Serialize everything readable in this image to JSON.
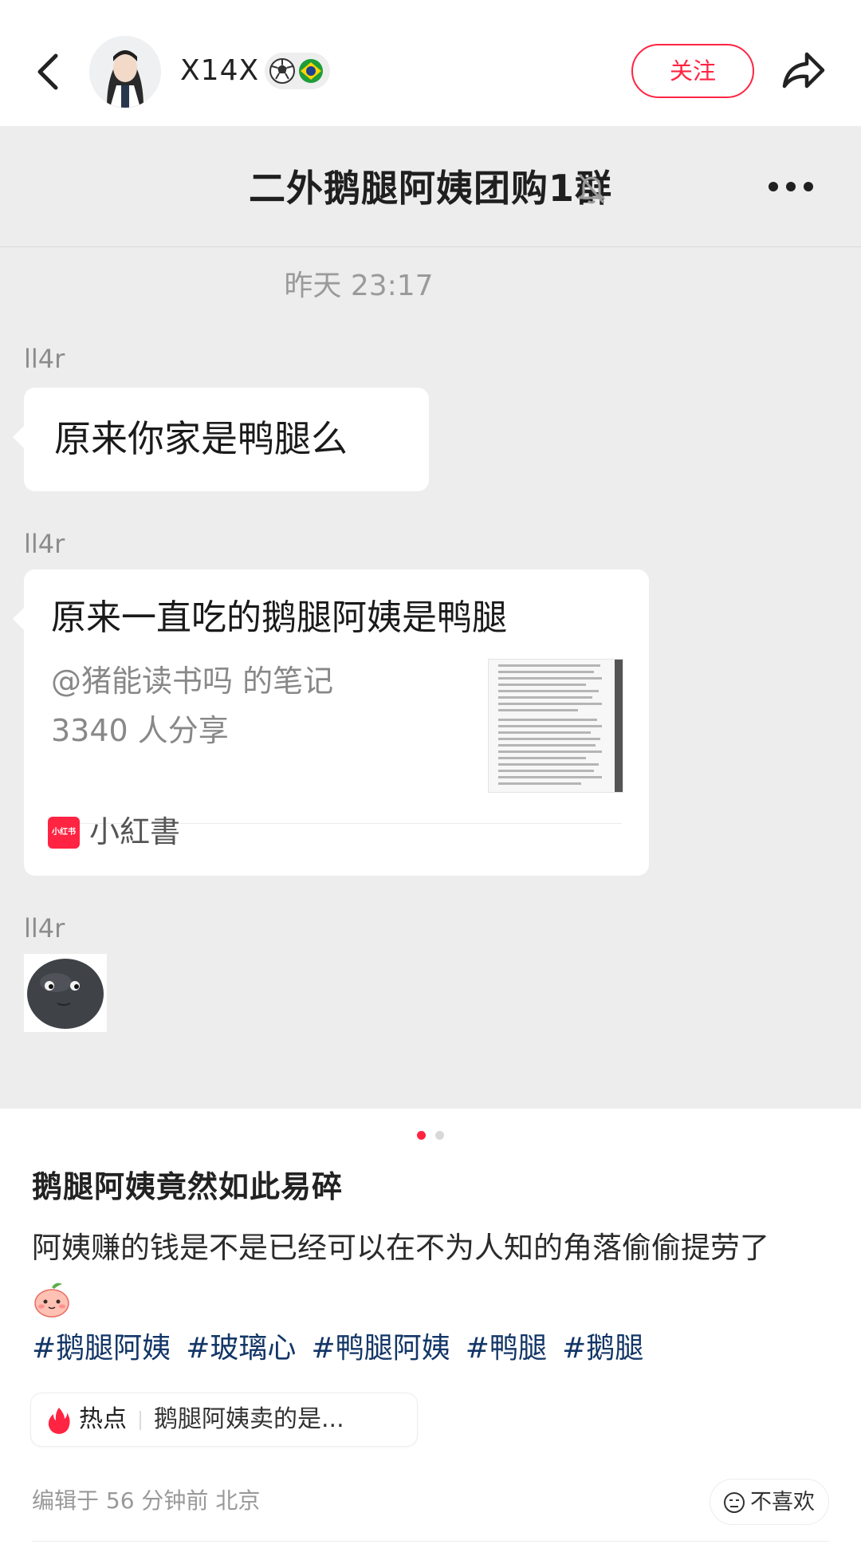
{
  "header": {
    "author_name": "X14X",
    "follow_label": "关注",
    "icons": {
      "back": "chevron-left-icon",
      "share": "share-arrow-icon",
      "badge": "soccer-ball-brazil-flag-badge"
    }
  },
  "image": {
    "chat": {
      "title": "二外鹅腿阿姨团购1群",
      "timestamp": "昨天 23:17",
      "messages": [
        {
          "sender": "ll4r",
          "text": "原来你家是鸭腿么"
        },
        {
          "sender": "ll4r",
          "card": {
            "title": "原来一直吃的鹅腿阿姨是鸭腿",
            "author_line": "@猪能读书吗 的笔记",
            "share_count": "3340 人分享",
            "app_name": "小紅書",
            "app_icon_text": "小红书"
          }
        },
        {
          "sender": "ll4r",
          "sticker": "dark-moon-face-sticker"
        }
      ]
    },
    "carousel": {
      "current": 1,
      "total": 2
    }
  },
  "post": {
    "title": "鹅腿阿姨竟然如此易碎",
    "content": "阿姨赚的钱是不是已经可以在不为人知的角落偷偷提劳了",
    "tags": [
      "#鹅腿阿姨",
      "#玻璃心",
      "#鸭腿阿姨",
      "#鸭腿",
      "#鹅腿"
    ],
    "hot": {
      "label": "热点",
      "text": "鹅腿阿姨卖的是..."
    },
    "meta": "编辑于 56 分钟前 北京",
    "dislike_label": "不喜欢"
  },
  "colors": {
    "accent": "#ff2442",
    "tag": "#133667",
    "chat_bg": "#ededed"
  }
}
